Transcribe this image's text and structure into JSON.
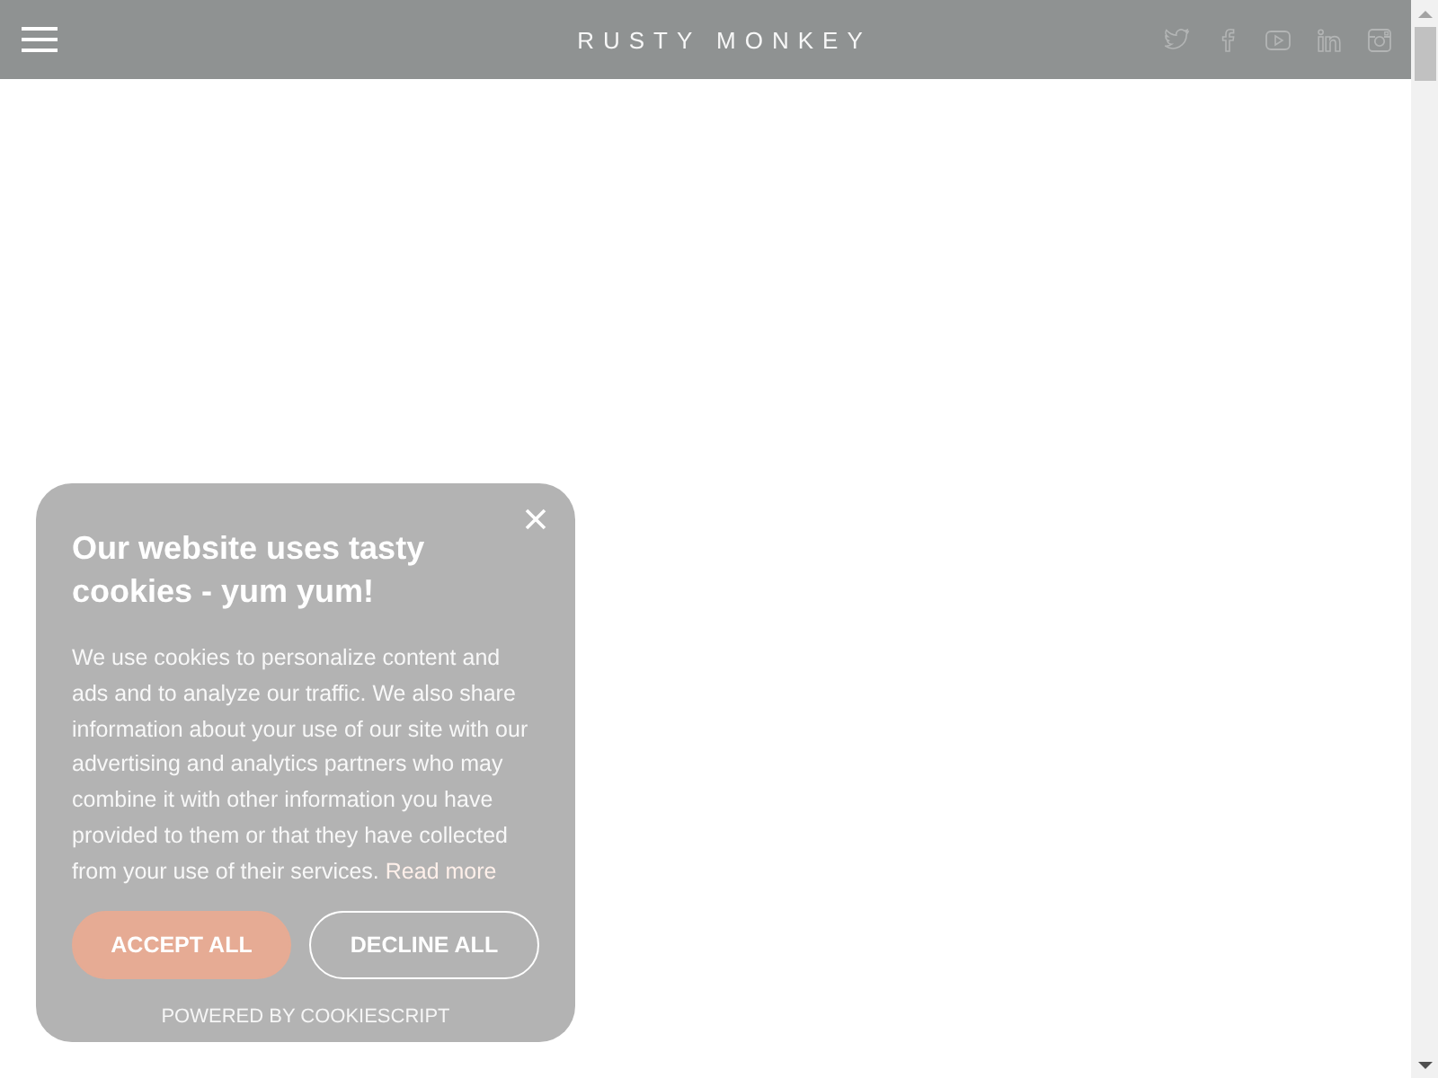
{
  "header": {
    "logo": "RUSTY MONKEY"
  },
  "cookie_banner": {
    "title": "Our website uses tasty cookies - yum yum!",
    "body": "We use cookies to personalize content and ads and to analyze our traffic. We also share information about your use of our site with our advertising and analytics partners who may combine it with other information you have provided to them or that they have collected from your use of their services.",
    "link": "Read more",
    "buttons": [
      {
        "label": "ACCEPT ALL",
        "kind": "primary"
      },
      {
        "label": "DECLINE ALL",
        "kind": "outline"
      }
    ],
    "footer": "POWERED BY COOKIESCRIPT"
  }
}
